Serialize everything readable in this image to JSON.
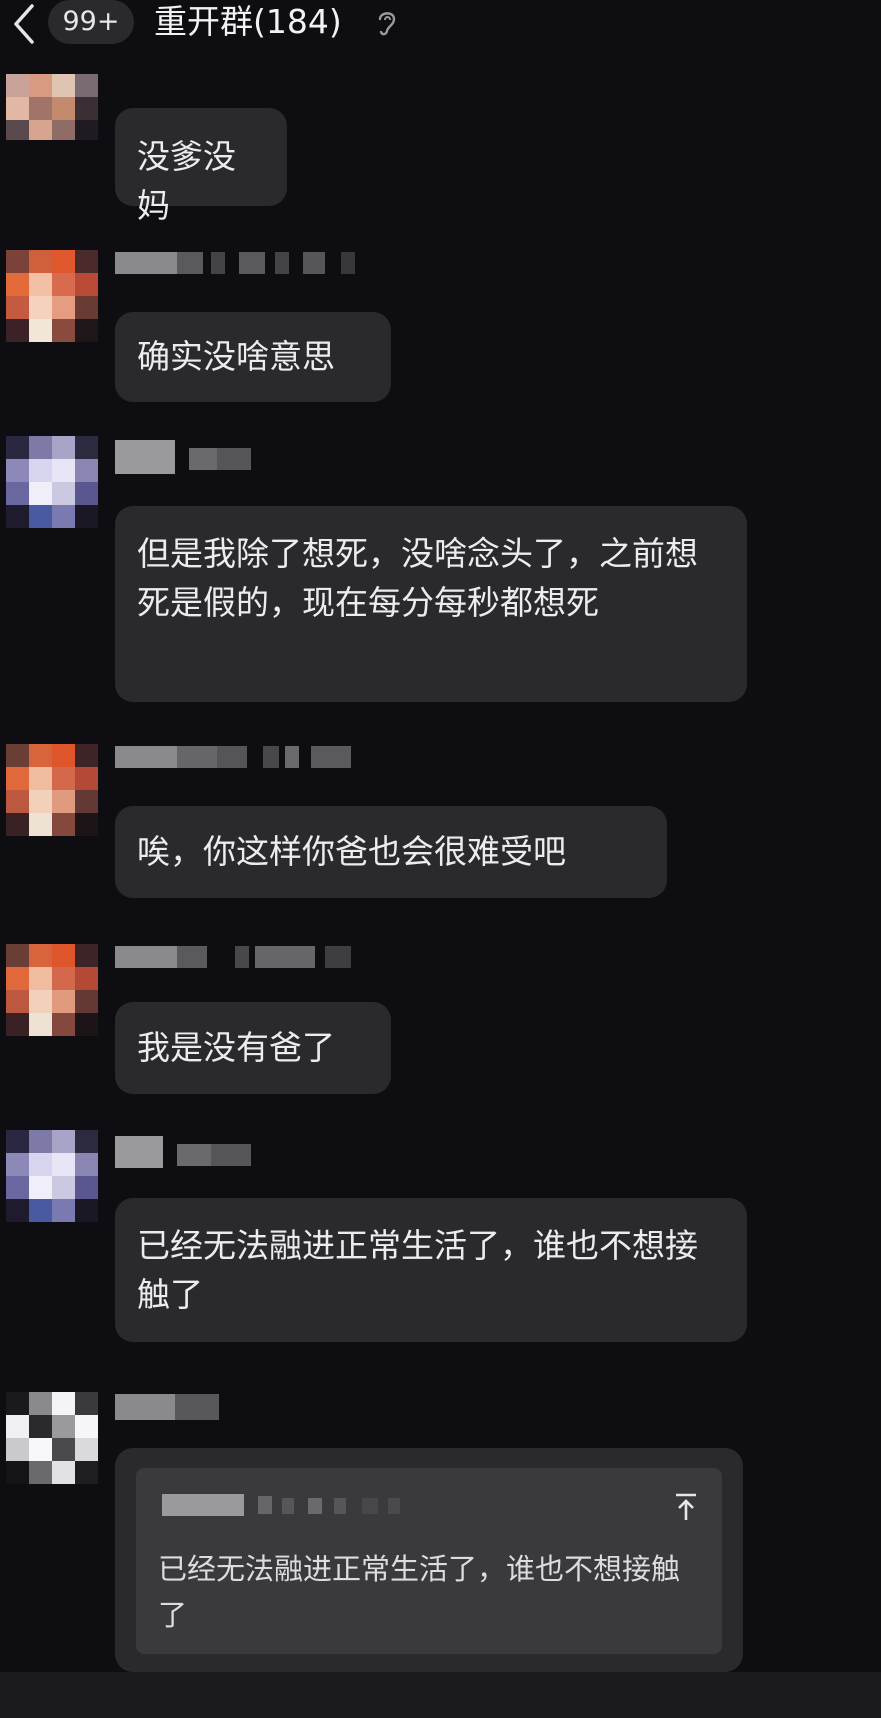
{
  "header": {
    "back_icon": "chevron-left-icon",
    "unread_badge": "99+",
    "title": "重开群(184)",
    "ear_icon": "ear-icon"
  },
  "messages": [
    {
      "text": "没爹没妈"
    },
    {
      "text": "确实没啥意思"
    },
    {
      "text": "但是我除了想死，没啥念头了，之前想死是假的，现在每分每秒都想死"
    },
    {
      "text": "唉，你这样你爸也会很难受吧"
    },
    {
      "text": "我是没有爸了"
    },
    {
      "text": "已经无法融进正常生活了，谁也不想接触了"
    },
    {
      "quote_text": "已经无法融进正常生活了，谁也不想接触了",
      "quote_icon": "scroll-to-top-icon"
    }
  ],
  "colors": {
    "background": "#0e0d12",
    "bubble": "#2a2a2e",
    "quote": "#3a3a3e",
    "text": "#ececee"
  }
}
